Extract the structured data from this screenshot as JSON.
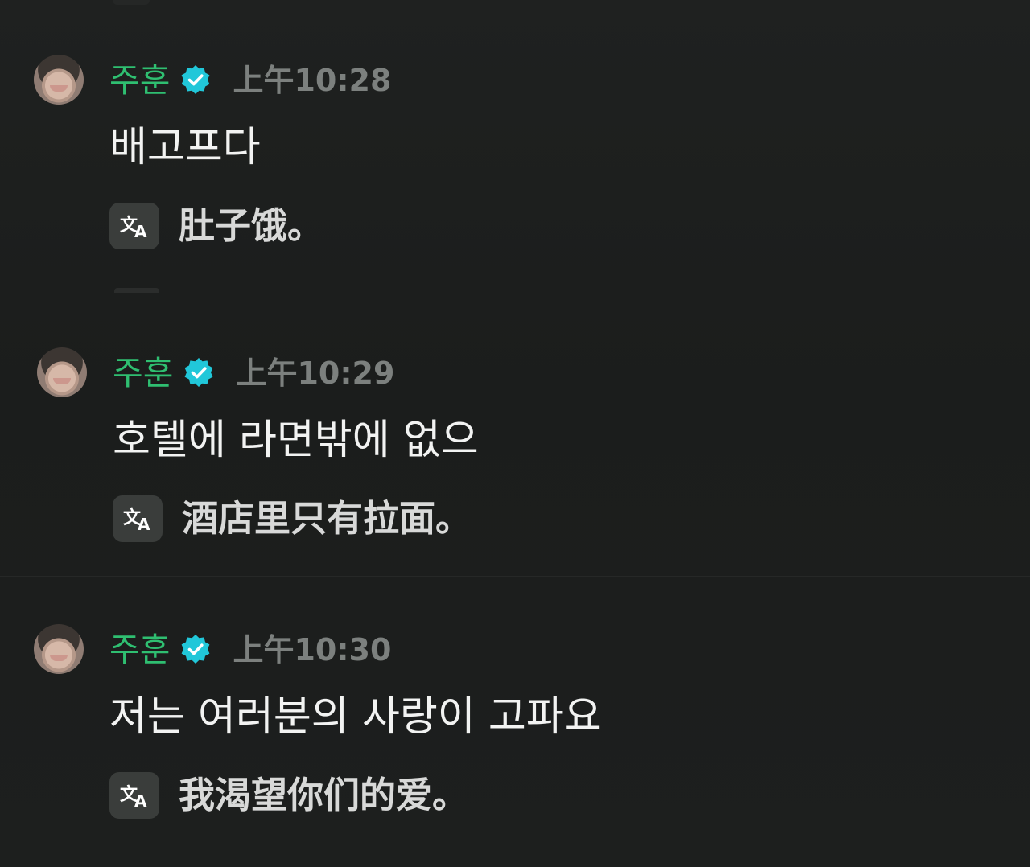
{
  "colors": {
    "background": "#1c1e1d",
    "username": "#2fbf71",
    "verified_badge": "#21c7d9",
    "timestamp": "#7c807e",
    "message_text": "#f2f3f2",
    "translation_text": "#d8d9d8",
    "translate_button_bg": "#3a3d3b"
  },
  "messages": [
    {
      "username": "주훈",
      "verified_icon": "verified-badge-icon",
      "timestamp": "上午10:28",
      "text": "배고프다",
      "translate_icon": "translate-icon",
      "translation": "肚子饿。"
    },
    {
      "username": "주훈",
      "verified_icon": "verified-badge-icon",
      "timestamp": "上午10:29",
      "text": "호텔에 라면밖에 없으",
      "translate_icon": "translate-icon",
      "translation": "酒店里只有拉面。"
    },
    {
      "username": "주훈",
      "verified_icon": "verified-badge-icon",
      "timestamp": "上午10:30",
      "text": "저는 여러분의 사랑이 고파요",
      "translate_icon": "translate-icon",
      "translation": "我渴望你们的爱。"
    }
  ]
}
